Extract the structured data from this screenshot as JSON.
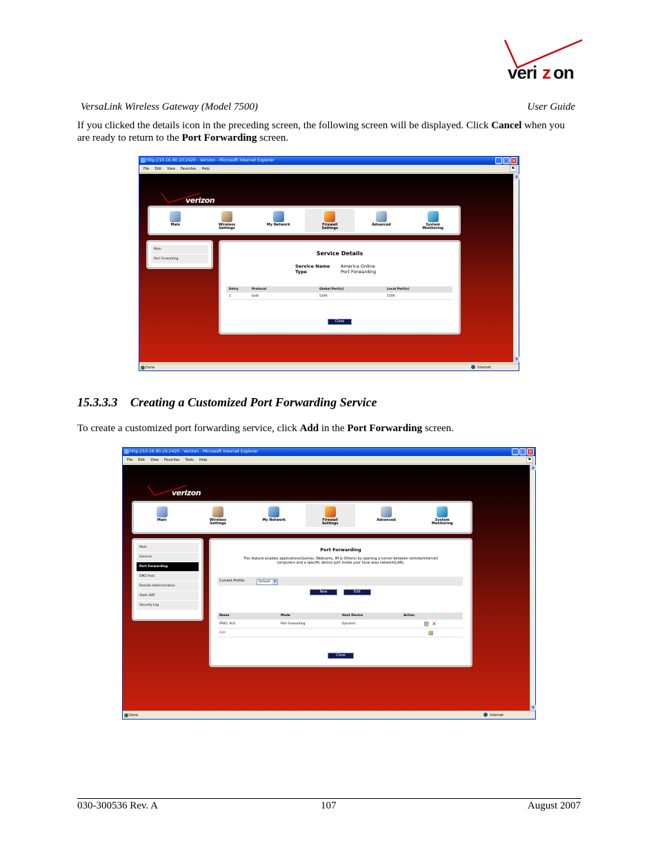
{
  "brand": {
    "logo_text": "verizon"
  },
  "doc_header": {
    "left": "VersaLink Wireless Gateway (Model 7500)",
    "right": "User Guide"
  },
  "intro": {
    "t1": "If you clicked the details icon in the preceding screen, the following screen will be displayed. Click ",
    "b1": "Cancel",
    "t2": " when you are ready to return to the ",
    "b2": "Port Forwarding",
    "t3": " screen."
  },
  "section": {
    "number": "15.3.3.3",
    "title": "Creating a Customized Port Forwarding Service"
  },
  "section_text": {
    "t1": "To create a customized port forwarding service, click ",
    "b1": "Add",
    "t2": " in the ",
    "b2": "Port Forwarding",
    "t3": " screen."
  },
  "browser": {
    "title": "http://10.16.90.10:2420 - Verizon - Microsoft Internet Explorer",
    "menu1": [
      "File",
      "Edit",
      "View",
      "Favorites",
      "Help"
    ],
    "menu2": [
      "File",
      "Edit",
      "View",
      "Favorites",
      "Tools",
      "Help"
    ],
    "status": "Done",
    "zone": "Internet"
  },
  "nav": [
    {
      "l1": "Main",
      "l2": ""
    },
    {
      "l1": "Wireless",
      "l2": "Settings"
    },
    {
      "l1": "My Network",
      "l2": ""
    },
    {
      "l1": "Firewall",
      "l2": "Settings"
    },
    {
      "l1": "Advanced",
      "l2": ""
    },
    {
      "l1": "System",
      "l2": "Monitoring"
    }
  ],
  "screen1": {
    "sidebar": [
      "Main",
      "Port Forwarding"
    ],
    "title": "Service Details",
    "service_name_label": "Service Name",
    "service_name_value": "America Online",
    "type_label": "Type",
    "type_value": "Port Forwarding",
    "columns": [
      "Entry",
      "Protocol",
      "Global Port(s)",
      "Local Port(s)"
    ],
    "row": [
      "1",
      "both",
      "5190",
      "5190"
    ],
    "close_label": "Close"
  },
  "screen2": {
    "sidebar": [
      "Main",
      "General",
      "Port Forwarding",
      "DMZ Host",
      "Remote Administration",
      "Static NAT",
      "Security Log"
    ],
    "title": "Port Forwarding",
    "desc1": "This feature enables applications(Games, Webcams, IM & Others) by opening a tunnel between remote(Internet)",
    "desc2": "computers and a specific device port inside your local area network(LAN).",
    "profile_label": "Current Profile:",
    "profile_value": "Default",
    "new_label": "New",
    "edit_label": "Edit",
    "columns": [
      "Name",
      "Mode",
      "Host Device",
      "Action"
    ],
    "row": [
      "IPSEC ALG",
      "Port Forwarding",
      "Dynamic"
    ],
    "add_label": "Add",
    "close_label": "Close"
  },
  "footer": {
    "left": "030-300536 Rev. A",
    "center": "107",
    "right": "August 2007"
  },
  "colors": {
    "brand_red": "#cd040b",
    "window_blue": "#0a4fd8",
    "button_navy": "#101a4e"
  }
}
